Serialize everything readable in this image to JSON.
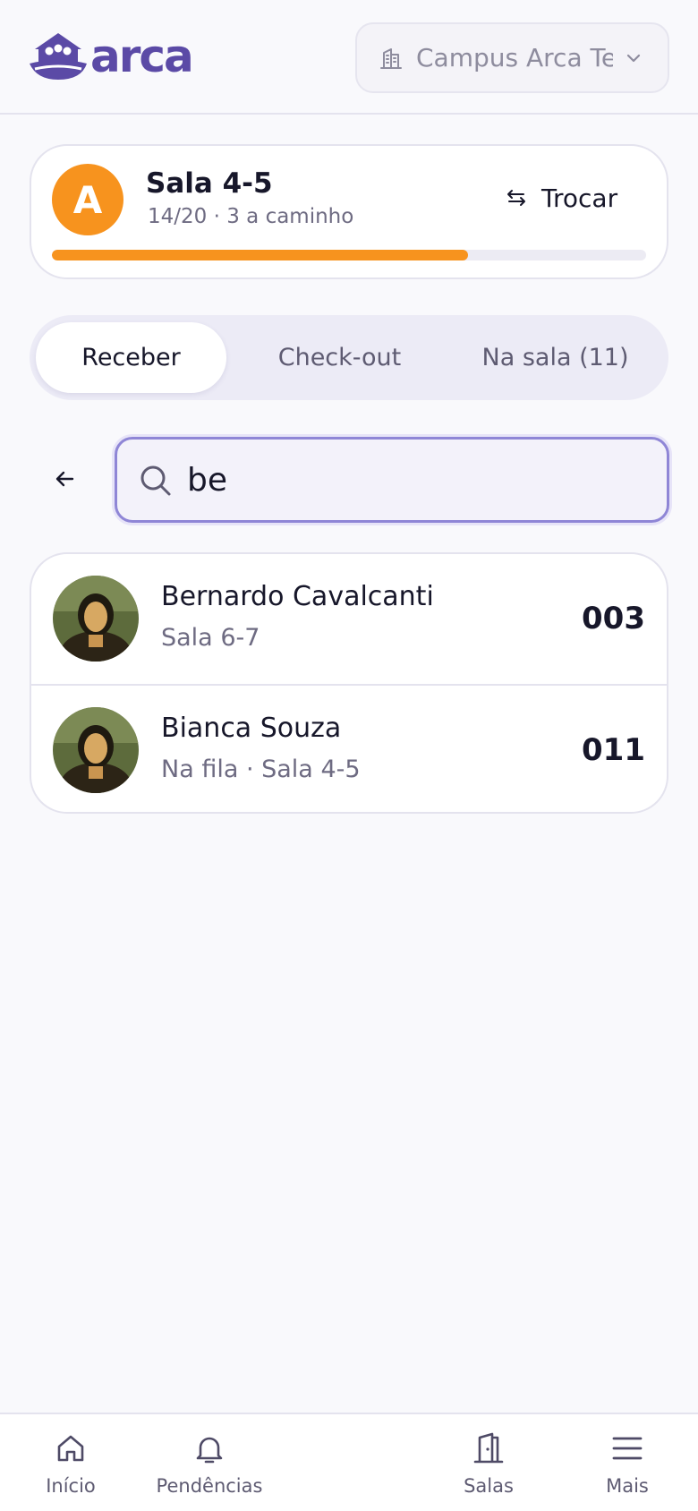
{
  "header": {
    "logo_text": "arca",
    "campus_name": "Campus Arca Te",
    "icons": {
      "campus": "building-icon",
      "dropdown": "chevron-down-icon"
    }
  },
  "room": {
    "avatar_letter": "A",
    "title": "Sala 4-5",
    "subtitle": "14/20 · 3 a caminho",
    "swap_label": "Trocar",
    "occupancy_fraction": 0.7,
    "accent_color": "#f7931e"
  },
  "tabs": [
    {
      "label": "Receber",
      "active": true
    },
    {
      "label": "Check-out",
      "active": false
    },
    {
      "label": "Na sala (11)",
      "active": false
    }
  ],
  "search": {
    "value": "be",
    "icons": {
      "back": "arrow-left-icon",
      "search": "search-icon"
    }
  },
  "results": [
    {
      "name": "Bernardo Cavalcanti",
      "detail": "Sala 6-7",
      "code": "003"
    },
    {
      "name": "Bianca Souza",
      "detail": "Na fila · Sala 4-5",
      "code": "011"
    }
  ],
  "bottom_nav": [
    {
      "label": "Início",
      "icon": "home-icon"
    },
    {
      "label": "Pendências",
      "icon": "bell-icon"
    },
    {
      "label": "Salas",
      "icon": "door-icon"
    },
    {
      "label": "Mais",
      "icon": "menu-icon"
    }
  ],
  "colors": {
    "brand": "#5b4aa6",
    "accent": "#f7931e",
    "background": "#f9f9fc"
  }
}
